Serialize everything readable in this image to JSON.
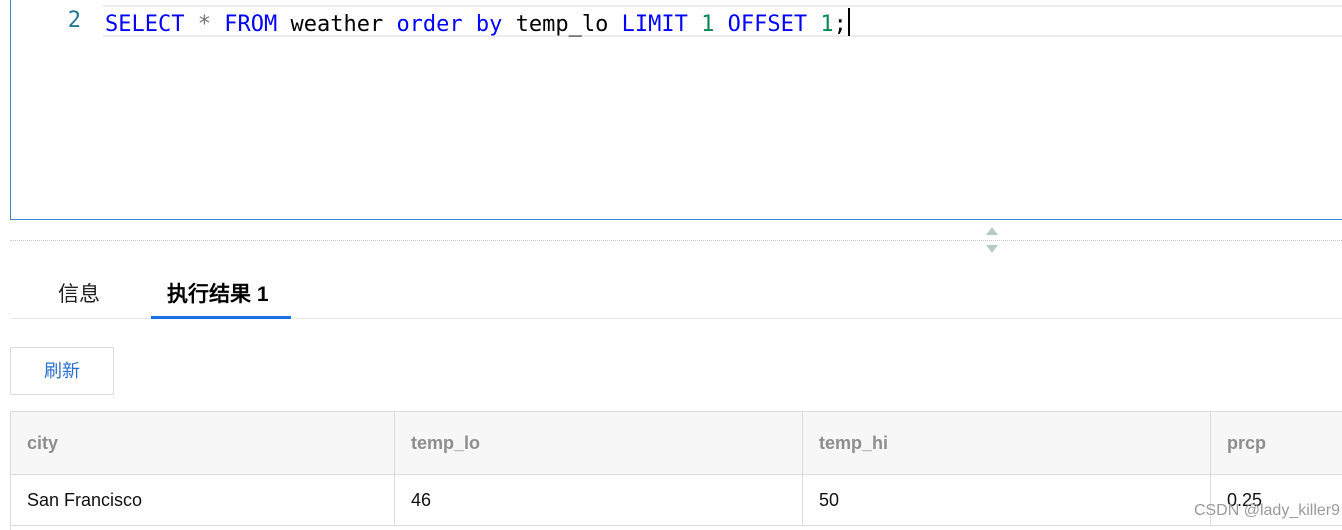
{
  "editor": {
    "line_number": "2",
    "tokens": {
      "select": "SELECT",
      "star": "*",
      "from": "FROM",
      "table": "weather",
      "order": "order",
      "by": "by",
      "column": "temp_lo",
      "limit": "LIMIT",
      "limit_value": "1",
      "offset": "OFFSET",
      "offset_value": "1",
      "semicolon": ";"
    }
  },
  "tabs": {
    "info": "信息",
    "result": "执行结果 1"
  },
  "toolbar": {
    "refresh_label": "刷新"
  },
  "table": {
    "columns": [
      "city",
      "temp_lo",
      "temp_hi",
      "prcp"
    ],
    "rows": [
      [
        "San Francisco",
        "46",
        "50",
        "0.25"
      ]
    ]
  },
  "watermark": "CSDN @lady_killer9",
  "colors": {
    "keyword": "#0000ff",
    "number": "#098658",
    "accent": "#1a73e8",
    "editor_border": "#3f86d6"
  }
}
